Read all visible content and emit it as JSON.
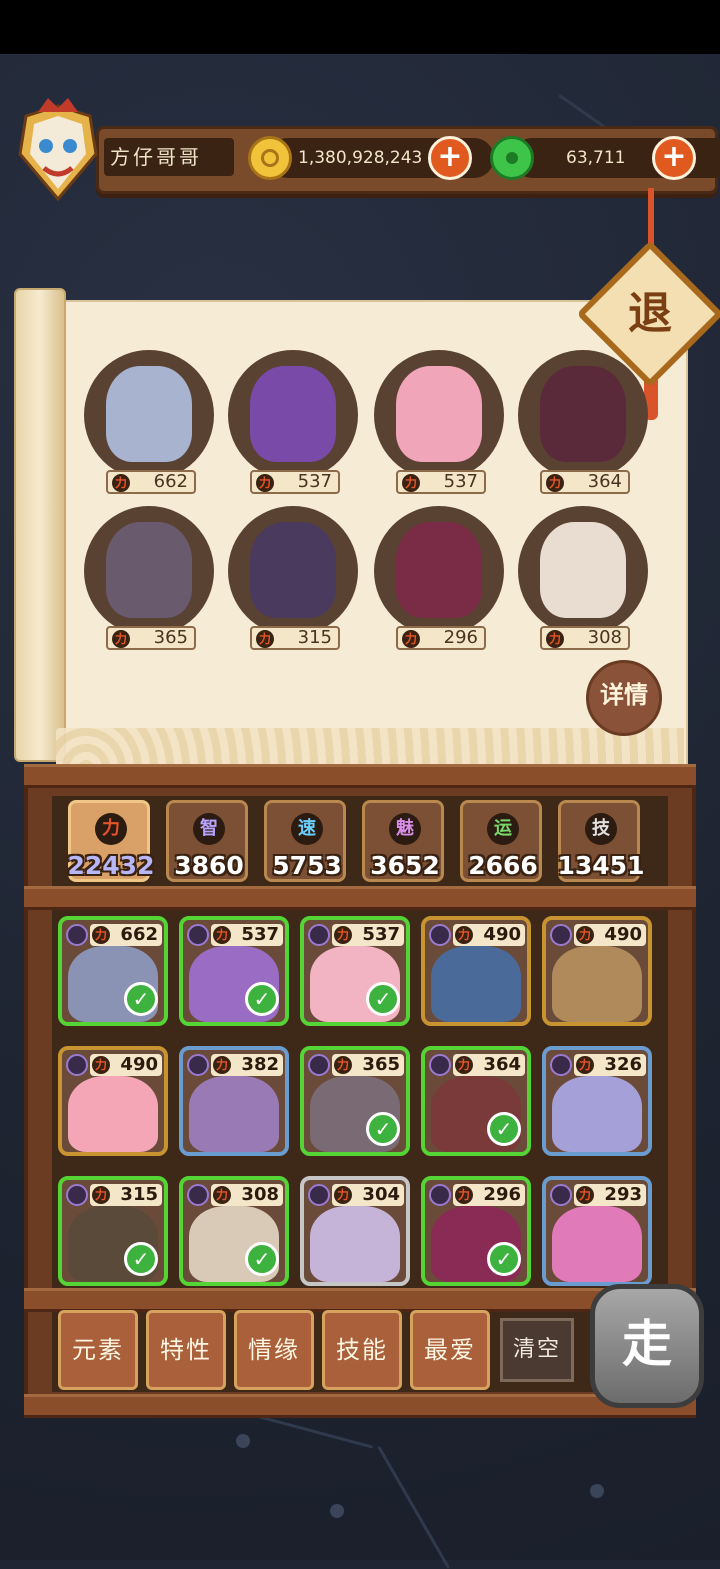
{
  "player": {
    "name": "方仔哥哥"
  },
  "currency": {
    "gold": "1,380,928,243",
    "jade": "63,711",
    "add_label": "+"
  },
  "exit": {
    "label": "退"
  },
  "power_glyph": "力",
  "team": [
    {
      "power": "662",
      "color": "#a7b3cf"
    },
    {
      "power": "537",
      "color": "#7a4aa8"
    },
    {
      "power": "537",
      "color": "#f0a6b8"
    },
    {
      "power": "364",
      "color": "#5a2a3a"
    },
    {
      "power": "365",
      "color": "#6a5a6e"
    },
    {
      "power": "315",
      "color": "#4a3a5e"
    },
    {
      "power": "296",
      "color": "#7a2b45"
    },
    {
      "power": "308",
      "color": "#e8ddd0"
    }
  ],
  "detail": {
    "label": "详情"
  },
  "stats": [
    {
      "icon": "力",
      "value": "22432",
      "icon_color": "#e6552a"
    },
    {
      "icon": "智",
      "value": "3860",
      "icon_color": "#b8a4ff"
    },
    {
      "icon": "速",
      "value": "5753",
      "icon_color": "#6ad0ff"
    },
    {
      "icon": "魅",
      "value": "3652",
      "icon_color": "#d88ee8"
    },
    {
      "icon": "运",
      "value": "2666",
      "icon_color": "#7ad86a"
    },
    {
      "icon": "技",
      "value": "13451",
      "icon_color": "#e0e0e0"
    }
  ],
  "roster": [
    {
      "power": "662",
      "color": "#8b93b5",
      "state": "selected"
    },
    {
      "power": "537",
      "color": "#9a6cc4",
      "state": "selected"
    },
    {
      "power": "537",
      "color": "#f2b4c2",
      "state": "selected"
    },
    {
      "power": "490",
      "color": "#4a6a9a",
      "state": "gold"
    },
    {
      "power": "490",
      "color": "#b08a5a",
      "state": "gold"
    },
    {
      "power": "490",
      "color": "#f4a6b6",
      "state": "gold"
    },
    {
      "power": "382",
      "color": "#9a7ab4",
      "state": "blue"
    },
    {
      "power": "365",
      "color": "#7a6a74",
      "state": "selected"
    },
    {
      "power": "364",
      "color": "#7a3a3a",
      "state": "selected"
    },
    {
      "power": "326",
      "color": "#a6a0d8",
      "state": "blue"
    },
    {
      "power": "315",
      "color": "#5a4a3a",
      "state": "selected"
    },
    {
      "power": "308",
      "color": "#d9cab8",
      "state": "selected"
    },
    {
      "power": "304",
      "color": "#c6b4d8",
      "state": "gray"
    },
    {
      "power": "296",
      "color": "#8a2b55",
      "state": "selected"
    },
    {
      "power": "293",
      "color": "#e07ab8",
      "state": "blue"
    }
  ],
  "check_glyph": "✓",
  "filters": [
    "元素",
    "特性",
    "情缘",
    "技能",
    "最爱"
  ],
  "clear": {
    "label": "清空"
  },
  "go": {
    "label": "走"
  }
}
